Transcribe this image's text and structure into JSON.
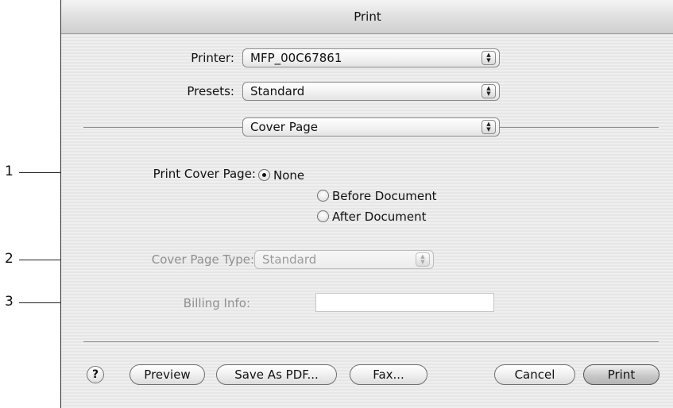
{
  "window": {
    "title": "Print"
  },
  "printer": {
    "label": "Printer:",
    "value": "MFP_00C67861"
  },
  "presets": {
    "label": "Presets:",
    "value": "Standard"
  },
  "panel": {
    "value": "Cover Page"
  },
  "cover_page": {
    "label": "Print Cover Page:",
    "options": [
      "None",
      "Before Document",
      "After Document"
    ],
    "selected": "None"
  },
  "cover_type": {
    "label": "Cover Page Type:",
    "value": "Standard"
  },
  "billing": {
    "label": "Billing Info:",
    "value": ""
  },
  "callouts": [
    "1",
    "2",
    "3"
  ],
  "buttons": {
    "help": "?",
    "preview": "Preview",
    "save_pdf": "Save As PDF...",
    "fax": "Fax...",
    "cancel": "Cancel",
    "print": "Print"
  }
}
